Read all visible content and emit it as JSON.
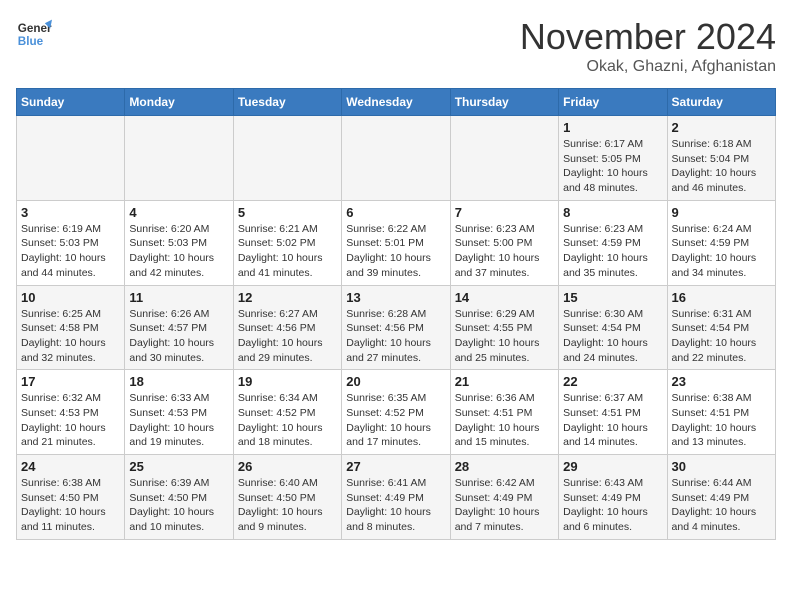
{
  "logo": {
    "line1": "General",
    "line2": "Blue"
  },
  "title": "November 2024",
  "location": "Okak, Ghazni, Afghanistan",
  "weekdays": [
    "Sunday",
    "Monday",
    "Tuesday",
    "Wednesday",
    "Thursday",
    "Friday",
    "Saturday"
  ],
  "weeks": [
    [
      {
        "day": "",
        "info": ""
      },
      {
        "day": "",
        "info": ""
      },
      {
        "day": "",
        "info": ""
      },
      {
        "day": "",
        "info": ""
      },
      {
        "day": "",
        "info": ""
      },
      {
        "day": "1",
        "info": "Sunrise: 6:17 AM\nSunset: 5:05 PM\nDaylight: 10 hours and 48 minutes."
      },
      {
        "day": "2",
        "info": "Sunrise: 6:18 AM\nSunset: 5:04 PM\nDaylight: 10 hours and 46 minutes."
      }
    ],
    [
      {
        "day": "3",
        "info": "Sunrise: 6:19 AM\nSunset: 5:03 PM\nDaylight: 10 hours and 44 minutes."
      },
      {
        "day": "4",
        "info": "Sunrise: 6:20 AM\nSunset: 5:03 PM\nDaylight: 10 hours and 42 minutes."
      },
      {
        "day": "5",
        "info": "Sunrise: 6:21 AM\nSunset: 5:02 PM\nDaylight: 10 hours and 41 minutes."
      },
      {
        "day": "6",
        "info": "Sunrise: 6:22 AM\nSunset: 5:01 PM\nDaylight: 10 hours and 39 minutes."
      },
      {
        "day": "7",
        "info": "Sunrise: 6:23 AM\nSunset: 5:00 PM\nDaylight: 10 hours and 37 minutes."
      },
      {
        "day": "8",
        "info": "Sunrise: 6:23 AM\nSunset: 4:59 PM\nDaylight: 10 hours and 35 minutes."
      },
      {
        "day": "9",
        "info": "Sunrise: 6:24 AM\nSunset: 4:59 PM\nDaylight: 10 hours and 34 minutes."
      }
    ],
    [
      {
        "day": "10",
        "info": "Sunrise: 6:25 AM\nSunset: 4:58 PM\nDaylight: 10 hours and 32 minutes."
      },
      {
        "day": "11",
        "info": "Sunrise: 6:26 AM\nSunset: 4:57 PM\nDaylight: 10 hours and 30 minutes."
      },
      {
        "day": "12",
        "info": "Sunrise: 6:27 AM\nSunset: 4:56 PM\nDaylight: 10 hours and 29 minutes."
      },
      {
        "day": "13",
        "info": "Sunrise: 6:28 AM\nSunset: 4:56 PM\nDaylight: 10 hours and 27 minutes."
      },
      {
        "day": "14",
        "info": "Sunrise: 6:29 AM\nSunset: 4:55 PM\nDaylight: 10 hours and 25 minutes."
      },
      {
        "day": "15",
        "info": "Sunrise: 6:30 AM\nSunset: 4:54 PM\nDaylight: 10 hours and 24 minutes."
      },
      {
        "day": "16",
        "info": "Sunrise: 6:31 AM\nSunset: 4:54 PM\nDaylight: 10 hours and 22 minutes."
      }
    ],
    [
      {
        "day": "17",
        "info": "Sunrise: 6:32 AM\nSunset: 4:53 PM\nDaylight: 10 hours and 21 minutes."
      },
      {
        "day": "18",
        "info": "Sunrise: 6:33 AM\nSunset: 4:53 PM\nDaylight: 10 hours and 19 minutes."
      },
      {
        "day": "19",
        "info": "Sunrise: 6:34 AM\nSunset: 4:52 PM\nDaylight: 10 hours and 18 minutes."
      },
      {
        "day": "20",
        "info": "Sunrise: 6:35 AM\nSunset: 4:52 PM\nDaylight: 10 hours and 17 minutes."
      },
      {
        "day": "21",
        "info": "Sunrise: 6:36 AM\nSunset: 4:51 PM\nDaylight: 10 hours and 15 minutes."
      },
      {
        "day": "22",
        "info": "Sunrise: 6:37 AM\nSunset: 4:51 PM\nDaylight: 10 hours and 14 minutes."
      },
      {
        "day": "23",
        "info": "Sunrise: 6:38 AM\nSunset: 4:51 PM\nDaylight: 10 hours and 13 minutes."
      }
    ],
    [
      {
        "day": "24",
        "info": "Sunrise: 6:38 AM\nSunset: 4:50 PM\nDaylight: 10 hours and 11 minutes."
      },
      {
        "day": "25",
        "info": "Sunrise: 6:39 AM\nSunset: 4:50 PM\nDaylight: 10 hours and 10 minutes."
      },
      {
        "day": "26",
        "info": "Sunrise: 6:40 AM\nSunset: 4:50 PM\nDaylight: 10 hours and 9 minutes."
      },
      {
        "day": "27",
        "info": "Sunrise: 6:41 AM\nSunset: 4:49 PM\nDaylight: 10 hours and 8 minutes."
      },
      {
        "day": "28",
        "info": "Sunrise: 6:42 AM\nSunset: 4:49 PM\nDaylight: 10 hours and 7 minutes."
      },
      {
        "day": "29",
        "info": "Sunrise: 6:43 AM\nSunset: 4:49 PM\nDaylight: 10 hours and 6 minutes."
      },
      {
        "day": "30",
        "info": "Sunrise: 6:44 AM\nSunset: 4:49 PM\nDaylight: 10 hours and 4 minutes."
      }
    ]
  ]
}
